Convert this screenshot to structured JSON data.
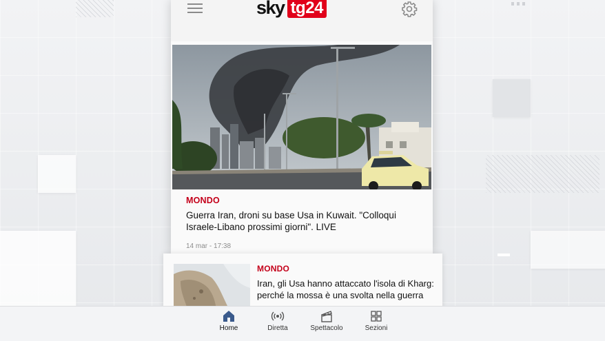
{
  "header": {
    "logo_sky": "sky",
    "logo_tg": "tg24"
  },
  "articles": [
    {
      "category": "MONDO",
      "headline": "Guerra Iran, droni su base Usa in Kuwait. \"Colloqui Israele-Libano prossimi giorni\". LIVE",
      "date": "14 mar - 17:38"
    },
    {
      "category": "MONDO",
      "headline": "Iran, gli Usa hanno attaccato l'isola di Kharg: perché la mossa è una svolta nella guerra"
    }
  ],
  "tabs": [
    {
      "label": "Home",
      "icon": "home-icon",
      "active": true
    },
    {
      "label": "Diretta",
      "icon": "broadcast-icon",
      "active": false
    },
    {
      "label": "Spettacolo",
      "icon": "clapperboard-icon",
      "active": false
    },
    {
      "label": "Sezioni",
      "icon": "grid-icon",
      "active": false
    }
  ],
  "colors": {
    "brand_red": "#e1001a",
    "category_red": "#c4001a",
    "active_tab": "#3a5a8c"
  }
}
